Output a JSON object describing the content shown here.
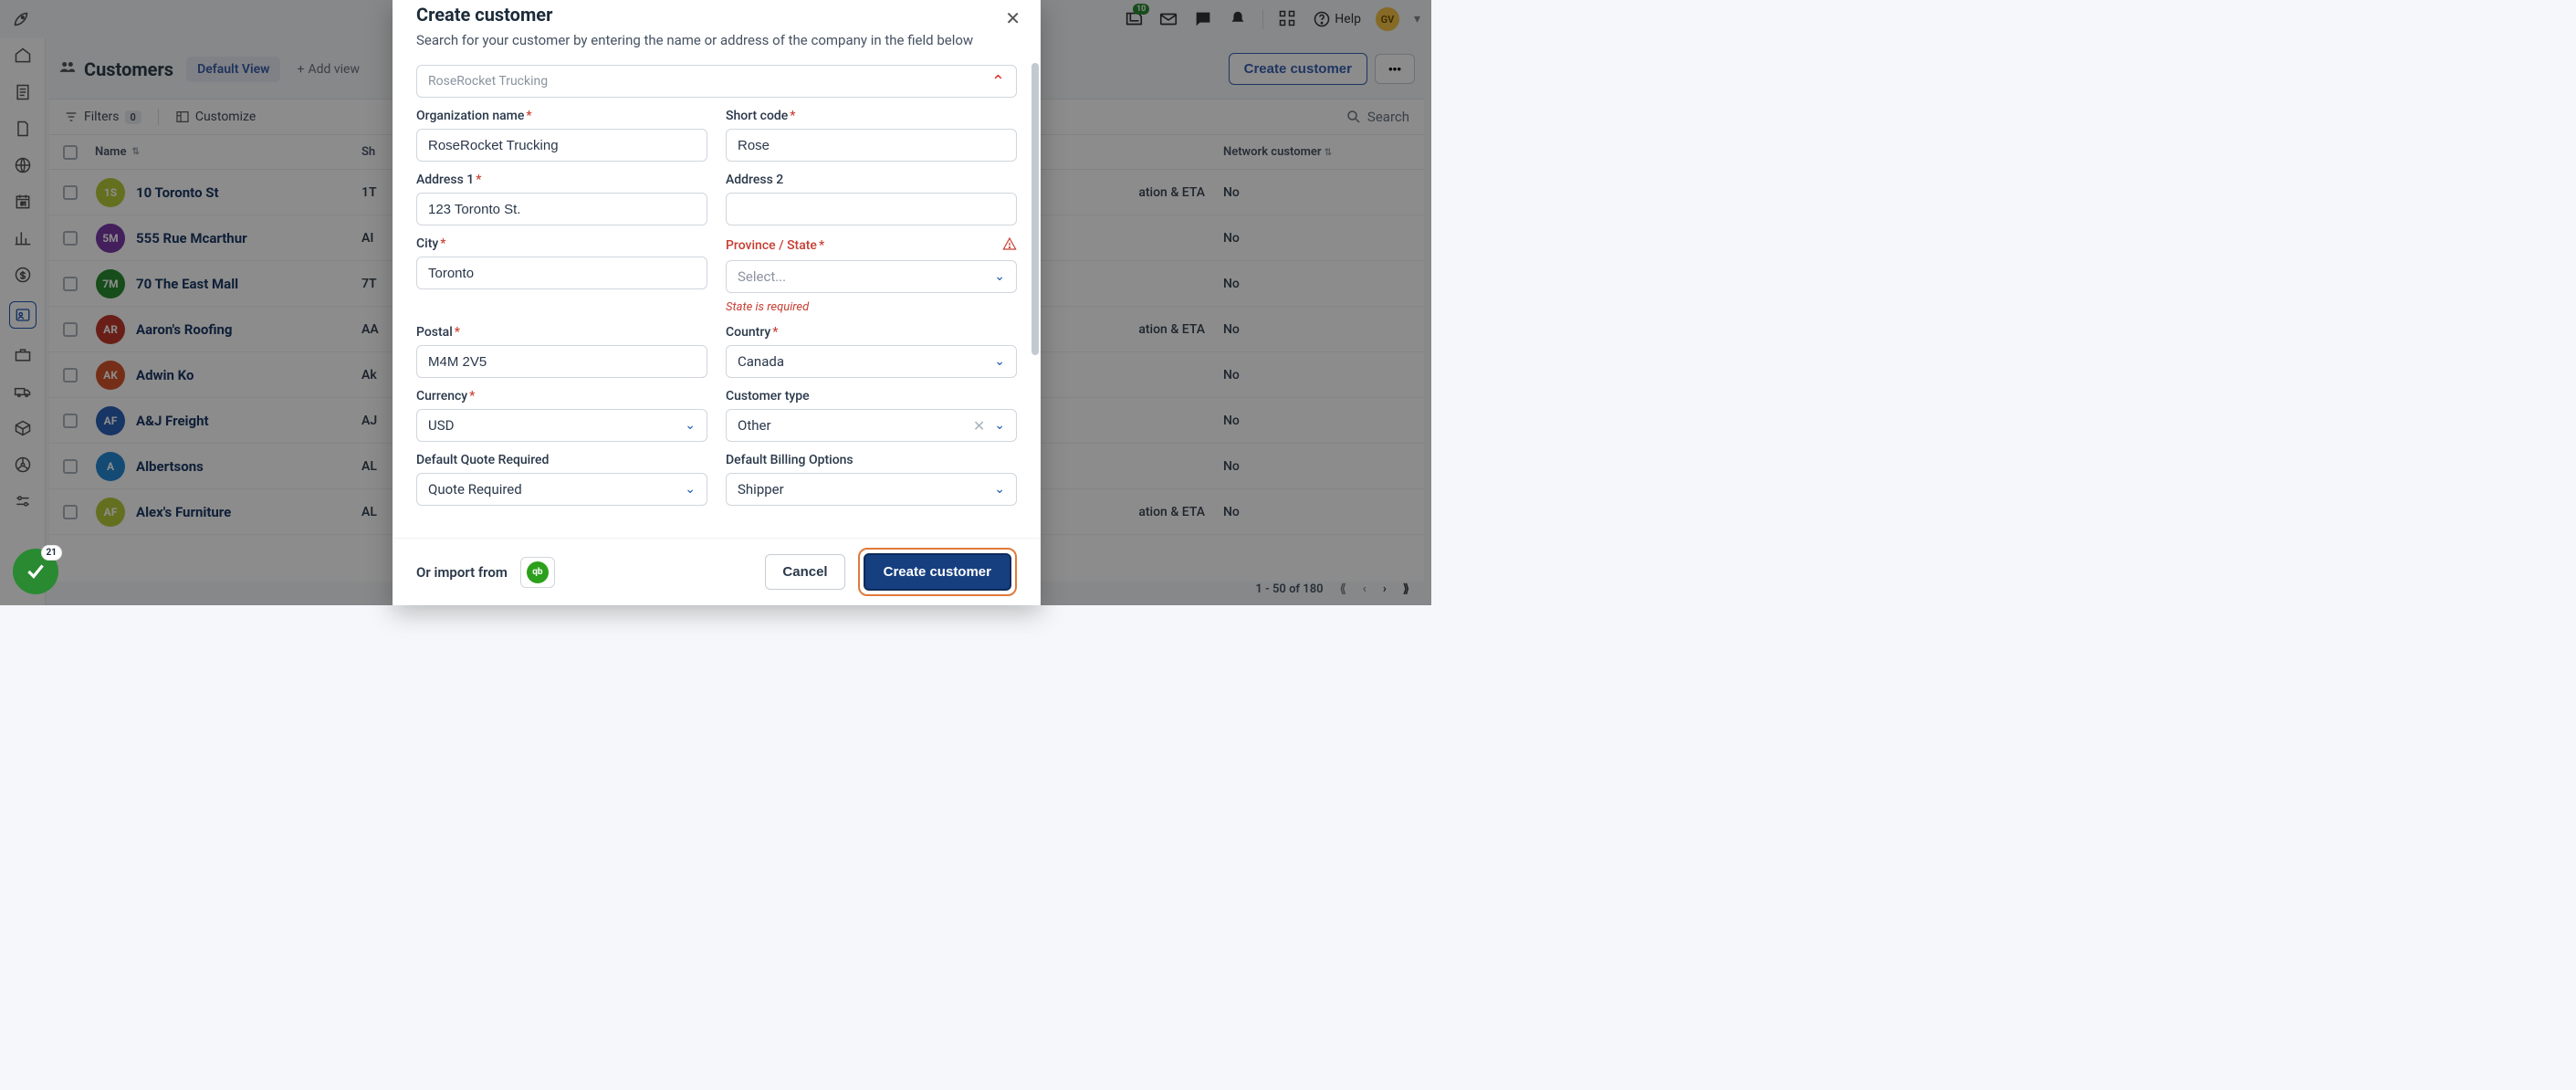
{
  "topbar": {
    "notif_badge": "10",
    "help_label": "Help",
    "avatar_initials": "GV"
  },
  "page": {
    "title": "Customers",
    "view_chip": "Default View",
    "add_view": "Add view",
    "create_button": "Create customer",
    "search_placeholder": "Search"
  },
  "toolbar": {
    "filters_label": "Filters",
    "filters_count": "0",
    "customize_label": "Customize"
  },
  "table": {
    "columns": {
      "name": "Name",
      "short": "Sh",
      "network": "Network customer"
    },
    "eta_text_full": "ation & ETA",
    "rows": [
      {
        "initials": "1S",
        "color": "#b7cc3a",
        "name": "10 Toronto St",
        "short": "1T",
        "eta": "ation & ETA",
        "net": "No"
      },
      {
        "initials": "5M",
        "color": "#7a3aa8",
        "name": "555 Rue Mcarthur",
        "short": "AI",
        "eta": "",
        "net": "No"
      },
      {
        "initials": "7M",
        "color": "#2a8a32",
        "name": "70 The East Mall",
        "short": "7T",
        "eta": "",
        "net": "No"
      },
      {
        "initials": "AR",
        "color": "#c03a2a",
        "name": "Aaron's Roofing",
        "short": "AA",
        "eta": "ation & ETA",
        "net": "No"
      },
      {
        "initials": "AK",
        "color": "#d6552a",
        "name": "Adwin Ko",
        "short": "Ak",
        "eta": "",
        "net": "No"
      },
      {
        "initials": "AF",
        "color": "#2a62b8",
        "name": "A&J Freight",
        "short": "AJ",
        "eta": "",
        "net": "No"
      },
      {
        "initials": "A",
        "color": "#2589d6",
        "name": "Albertsons",
        "short": "AL",
        "eta": "",
        "net": "No"
      },
      {
        "initials": "AF",
        "color": "#b7cc3a",
        "name": "Alex's Furniture",
        "short": "AL",
        "eta": "ation & ETA",
        "net": "No"
      }
    ]
  },
  "footer": {
    "range": "1 - 50 of 180"
  },
  "modal": {
    "title": "Create customer",
    "subtitle": "Search for your customer by entering the name or address of the company in the field below",
    "lookup_value": "RoseRocket Trucking",
    "fields": {
      "org_name_label": "Organization name",
      "org_name_value": "RoseRocket Trucking",
      "short_code_label": "Short code",
      "short_code_value": "Rose",
      "addr1_label": "Address 1",
      "addr1_value": "123 Toronto St.",
      "addr2_label": "Address 2",
      "addr2_value": "",
      "city_label": "City",
      "city_value": "Toronto",
      "state_label": "Province / State",
      "state_value": "Select...",
      "state_error": "State is required",
      "postal_label": "Postal",
      "postal_value": "M4M 2V5",
      "country_label": "Country",
      "country_value": "Canada",
      "currency_label": "Currency",
      "currency_value": "USD",
      "ctype_label": "Customer type",
      "ctype_value": "Other",
      "quote_label": "Default Quote Required",
      "quote_value": "Quote Required",
      "billing_label": "Default Billing Options",
      "billing_value": "Shipper"
    },
    "footer": {
      "import_label": "Or import from",
      "cancel": "Cancel",
      "submit": "Create customer"
    }
  },
  "toast": {
    "count": "21"
  }
}
